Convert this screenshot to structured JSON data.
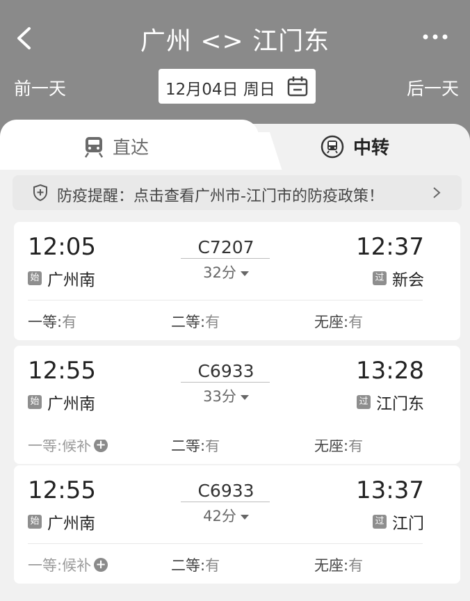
{
  "header": {
    "title": "广州 <> 江门东",
    "prev_day": "前一天",
    "next_day": "后一天",
    "date": "12月04日 周日"
  },
  "tabs": [
    {
      "label": "直达",
      "icon": "train-icon",
      "active": false
    },
    {
      "label": "中转",
      "icon": "transfer-train-icon",
      "active": true
    }
  ],
  "notice": {
    "text": "防疫提醒：点击查看广州市-江门市的防疫政策！",
    "icon": "shield-icon"
  },
  "trains": [
    {
      "dep_time": "12:05",
      "arr_time": "12:37",
      "train_no": "C7207",
      "duration": "32分",
      "from_tag": "始",
      "from_station": "广州南",
      "to_tag": "过",
      "to_station": "新会",
      "seats": [
        {
          "label": "一等:",
          "value": "有",
          "waitlist": false
        },
        {
          "label": "二等:",
          "value": "有",
          "waitlist": false
        },
        {
          "label": "无座:",
          "value": "有",
          "waitlist": false
        }
      ]
    },
    {
      "dep_time": "12:55",
      "arr_time": "13:28",
      "train_no": "C6933",
      "duration": "33分",
      "from_tag": "始",
      "from_station": "广州南",
      "to_tag": "过",
      "to_station": "江门东",
      "seats": [
        {
          "label": "一等:",
          "value": "候补",
          "waitlist": true
        },
        {
          "label": "二等:",
          "value": "有",
          "waitlist": false
        },
        {
          "label": "无座:",
          "value": "有",
          "waitlist": false
        }
      ]
    },
    {
      "dep_time": "12:55",
      "arr_time": "13:37",
      "train_no": "C6933",
      "duration": "42分",
      "from_tag": "始",
      "from_station": "广州南",
      "to_tag": "过",
      "to_station": "江门",
      "seats": [
        {
          "label": "一等:",
          "value": "候补",
          "waitlist": true
        },
        {
          "label": "二等:",
          "value": "有",
          "waitlist": false
        },
        {
          "label": "无座:",
          "value": "有",
          "waitlist": false
        }
      ]
    }
  ],
  "colors": {
    "header_bg": "#8a8a8a",
    "page_bg": "#f1f1f1",
    "card_bg": "#ffffff",
    "tag_bg": "#8e8e8e"
  }
}
